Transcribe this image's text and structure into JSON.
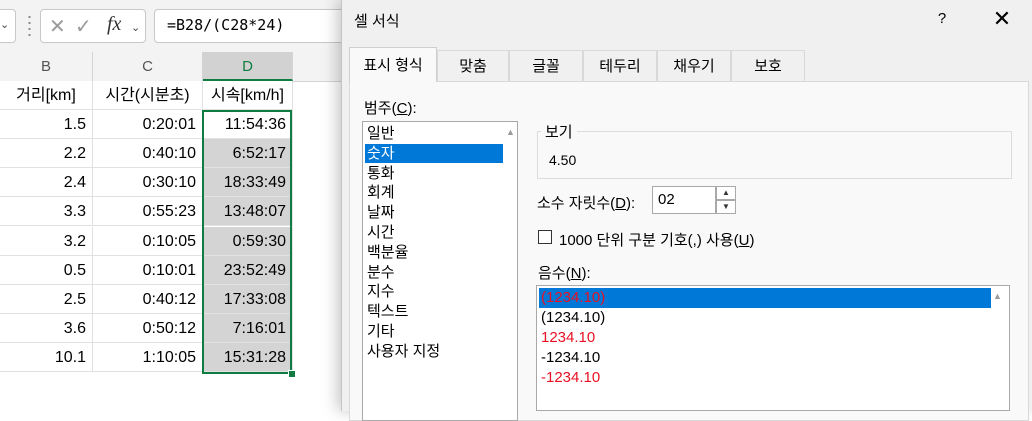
{
  "formula_bar": {
    "formula": "=B28/(C28*24)",
    "fx_label": "fx",
    "cancel_glyph": "✕",
    "enter_glyph": "✓"
  },
  "sheet": {
    "columns": [
      {
        "letter": "B",
        "selected": false
      },
      {
        "letter": "C",
        "selected": false
      },
      {
        "letter": "D",
        "selected": true
      }
    ],
    "headers": [
      "거리[km]",
      "시간(시분초)",
      "시속[km/h]"
    ],
    "rows": [
      [
        "1.5",
        "0:20:01",
        "11:54:36"
      ],
      [
        "2.2",
        "0:40:10",
        "6:52:17"
      ],
      [
        "2.4",
        "0:30:10",
        "18:33:49"
      ],
      [
        "3.3",
        "0:55:23",
        "13:48:07"
      ],
      [
        "3.2",
        "0:10:05",
        "0:59:30"
      ],
      [
        "0.5",
        "0:10:01",
        "23:52:49"
      ],
      [
        "2.5",
        "0:40:12",
        "17:33:08"
      ],
      [
        "3.6",
        "0:50:12",
        "7:16:01"
      ],
      [
        "10.1",
        "1:10:05",
        "15:31:28"
      ]
    ],
    "accent_color": "#107c41"
  },
  "dialog": {
    "title": "셀 서식",
    "help_label": "?",
    "close_label": "✕",
    "tabs": [
      {
        "label": "표시 형식",
        "active": true
      },
      {
        "label": "맞춤",
        "active": false
      },
      {
        "label": "글꼴",
        "active": false
      },
      {
        "label": "테두리",
        "active": false
      },
      {
        "label": "채우기",
        "active": false
      },
      {
        "label": "보호",
        "active": false
      }
    ],
    "category_label": "범주(",
    "category_key": "C",
    "category_label_end": "):",
    "categories": [
      "일반",
      "숫자",
      "통화",
      "회계",
      "날짜",
      "시간",
      "백분율",
      "분수",
      "지수",
      "텍스트",
      "기타",
      "사용자 지정"
    ],
    "selected_category": "숫자",
    "sample": {
      "title": "보기",
      "value": "4.50"
    },
    "decimal_places": {
      "label_start": "소수 자릿수(",
      "key": "D",
      "label_end": "):",
      "value": "02"
    },
    "use_separator": {
      "label_start": "1000 단위 구분 기호(,) 사용(",
      "key": "U",
      "label_end": ")",
      "checked": false
    },
    "negative": {
      "label_start": "음수(",
      "key": "N",
      "label_end": "):",
      "items": [
        {
          "text": "(1234.10)",
          "color": "#e81123",
          "selected": true
        },
        {
          "text": "(1234.10)",
          "color": "#000000",
          "selected": false
        },
        {
          "text": "1234.10",
          "color": "#e81123",
          "selected": false
        },
        {
          "text": "-1234.10",
          "color": "#000000",
          "selected": false
        },
        {
          "text": "-1234.10",
          "color": "#e81123",
          "selected": false
        }
      ]
    },
    "selection_color": "#0078d7"
  }
}
